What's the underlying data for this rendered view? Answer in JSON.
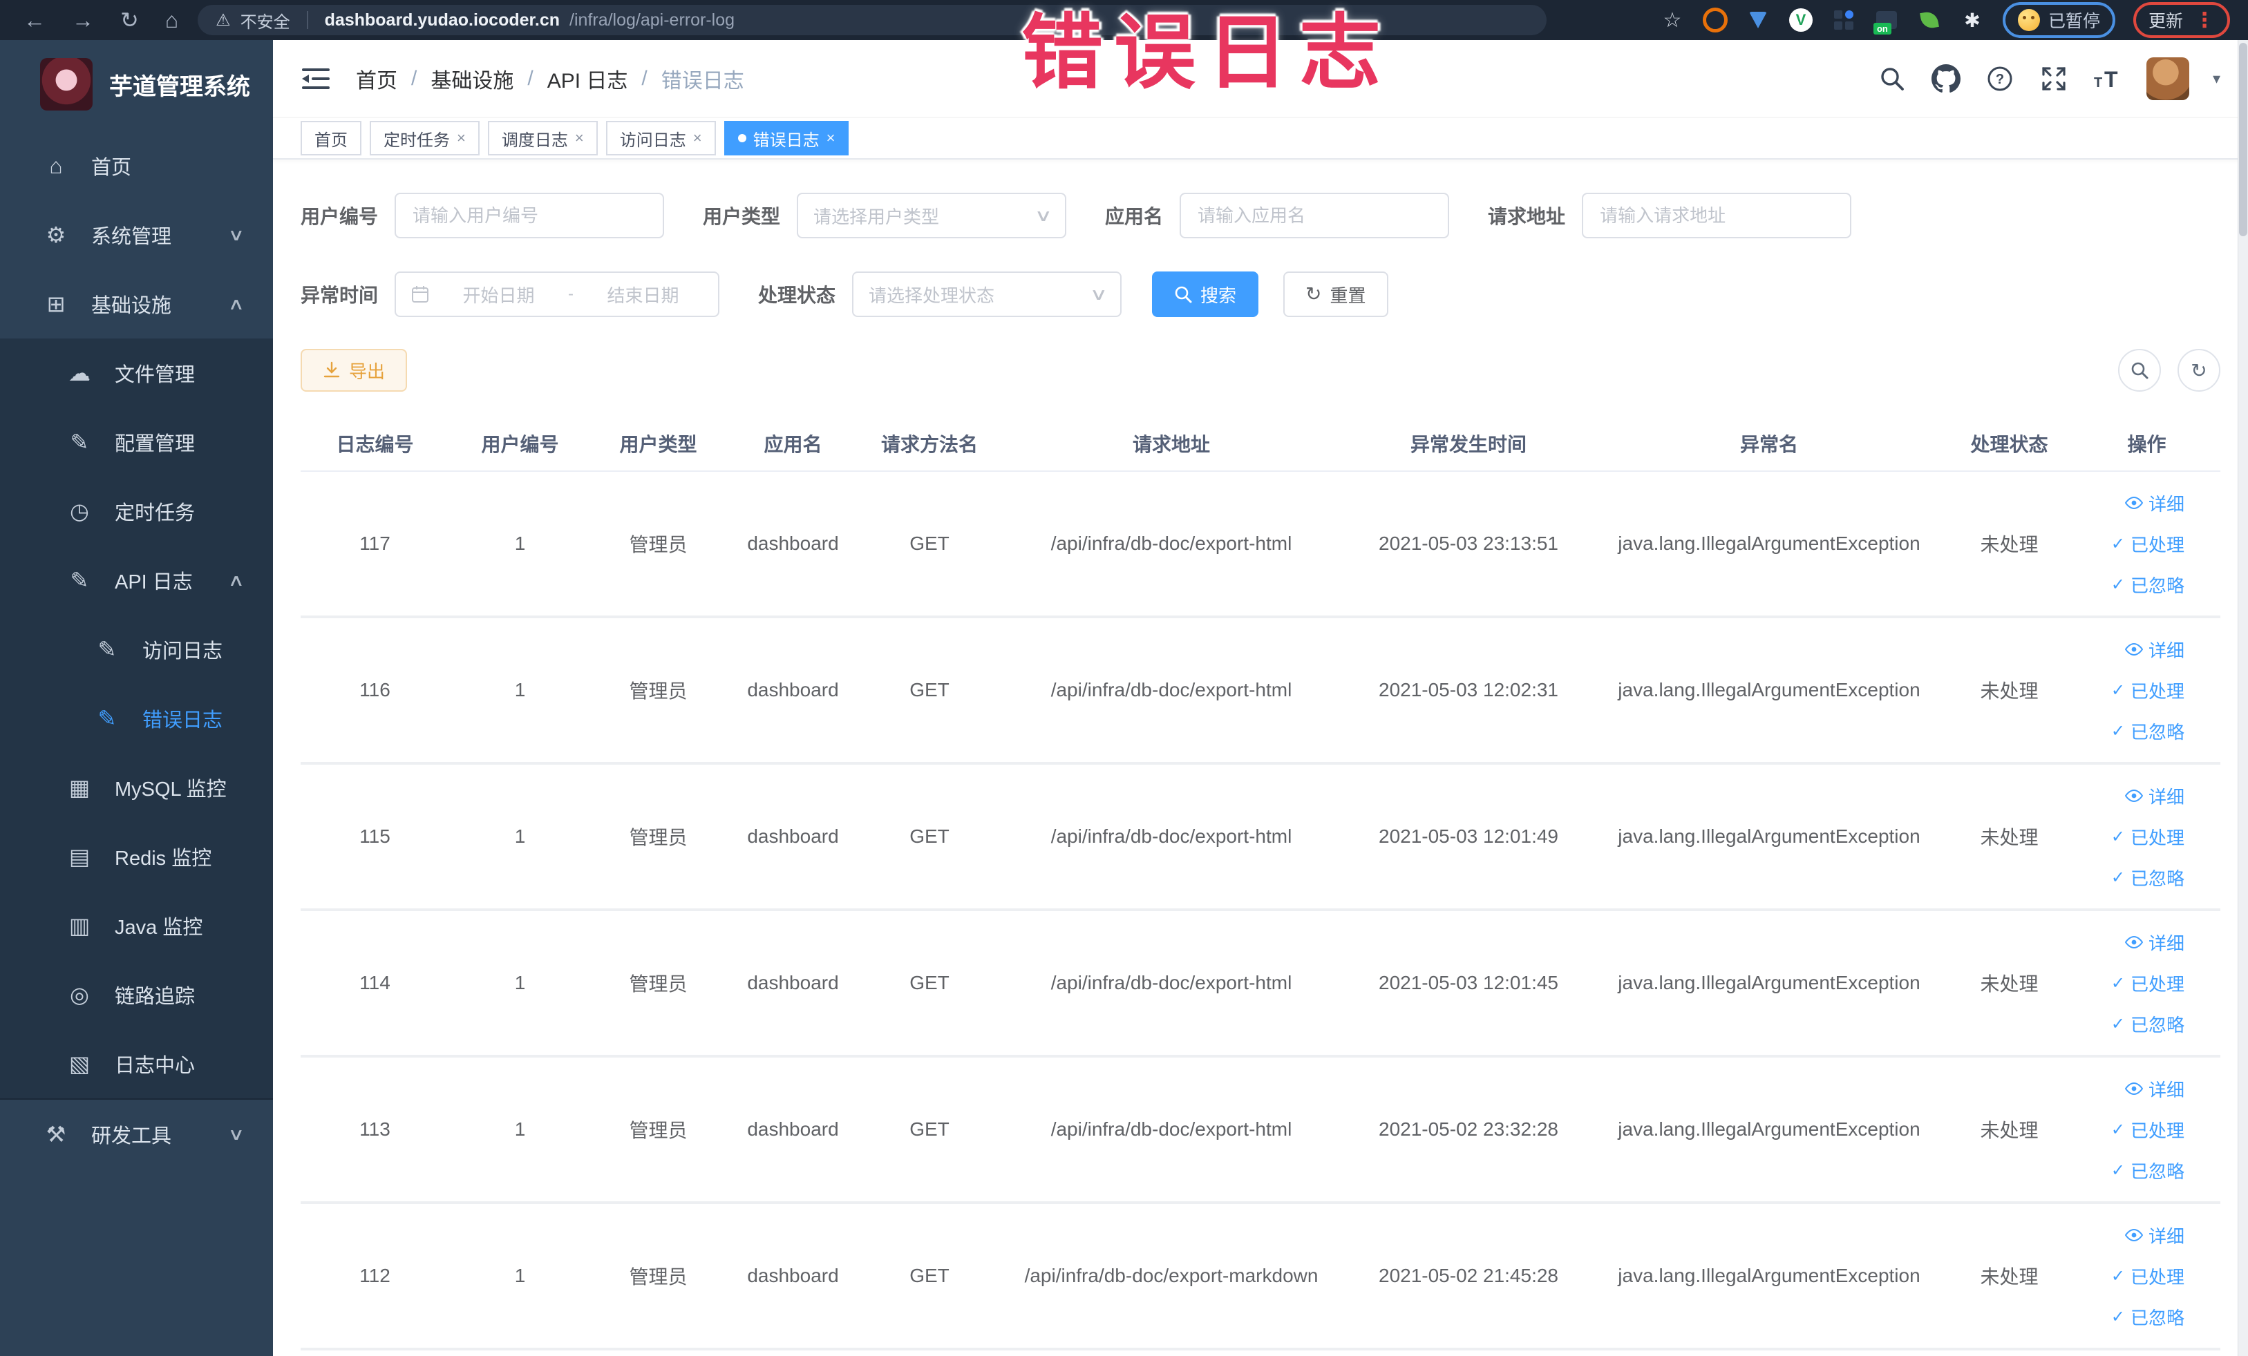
{
  "chrome": {
    "security_label": "不安全",
    "url_domain": "dashboard.yudao.iocoder.cn",
    "url_path": "/infra/log/api-error-log",
    "paused_label": "已暂停",
    "update_label": "更新"
  },
  "watermark": "错误日志",
  "sidebar": {
    "title": "芋道管理系统",
    "items": [
      {
        "label": "首页"
      },
      {
        "label": "系统管理"
      },
      {
        "label": "基础设施"
      },
      {
        "label": "文件管理"
      },
      {
        "label": "配置管理"
      },
      {
        "label": "定时任务"
      },
      {
        "label": "API 日志"
      },
      {
        "label": "访问日志"
      },
      {
        "label": "错误日志"
      },
      {
        "label": "MySQL 监控"
      },
      {
        "label": "Redis 监控"
      },
      {
        "label": "Java 监控"
      },
      {
        "label": "链路追踪"
      },
      {
        "label": "日志中心"
      },
      {
        "label": "研发工具"
      }
    ]
  },
  "breadcrumb": [
    "首页",
    "基础设施",
    "API 日志",
    "错误日志"
  ],
  "tabs": [
    {
      "label": "首页"
    },
    {
      "label": "定时任务"
    },
    {
      "label": "调度日志"
    },
    {
      "label": "访问日志"
    },
    {
      "label": "错误日志"
    }
  ],
  "filters": {
    "user_id": {
      "label": "用户编号",
      "placeholder": "请输入用户编号"
    },
    "user_type": {
      "label": "用户类型",
      "placeholder": "请选择用户类型"
    },
    "app_name": {
      "label": "应用名",
      "placeholder": "请输入应用名"
    },
    "request_url": {
      "label": "请求地址",
      "placeholder": "请输入请求地址"
    },
    "exception_time": {
      "label": "异常时间",
      "start_placeholder": "开始日期",
      "separator": "-",
      "end_placeholder": "结束日期"
    },
    "process_status": {
      "label": "处理状态",
      "placeholder": "请选择处理状态"
    },
    "search_label": "搜索",
    "reset_label": "重置"
  },
  "toolbar": {
    "export_label": "导出"
  },
  "table": {
    "headers": [
      "日志编号",
      "用户编号",
      "用户类型",
      "应用名",
      "请求方法名",
      "请求地址",
      "异常发生时间",
      "异常名",
      "处理状态",
      "操作"
    ],
    "action_labels": {
      "detail": "详细",
      "process": "已处理",
      "ignore": "已忽略"
    },
    "rows": [
      {
        "id": "117",
        "user_id": "1",
        "user_type": "管理员",
        "app": "dashboard",
        "method": "GET",
        "url": "/api/infra/db-doc/export-html",
        "time": "2021-05-03 23:13:51",
        "exception": "java.lang.IllegalArgumentException",
        "status": "未处理"
      },
      {
        "id": "116",
        "user_id": "1",
        "user_type": "管理员",
        "app": "dashboard",
        "method": "GET",
        "url": "/api/infra/db-doc/export-html",
        "time": "2021-05-03 12:02:31",
        "exception": "java.lang.IllegalArgumentException",
        "status": "未处理"
      },
      {
        "id": "115",
        "user_id": "1",
        "user_type": "管理员",
        "app": "dashboard",
        "method": "GET",
        "url": "/api/infra/db-doc/export-html",
        "time": "2021-05-03 12:01:49",
        "exception": "java.lang.IllegalArgumentException",
        "status": "未处理"
      },
      {
        "id": "114",
        "user_id": "1",
        "user_type": "管理员",
        "app": "dashboard",
        "method": "GET",
        "url": "/api/infra/db-doc/export-html",
        "time": "2021-05-03 12:01:45",
        "exception": "java.lang.IllegalArgumentException",
        "status": "未处理"
      },
      {
        "id": "113",
        "user_id": "1",
        "user_type": "管理员",
        "app": "dashboard",
        "method": "GET",
        "url": "/api/infra/db-doc/export-html",
        "time": "2021-05-02 23:32:28",
        "exception": "java.lang.IllegalArgumentException",
        "status": "未处理"
      },
      {
        "id": "112",
        "user_id": "1",
        "user_type": "管理员",
        "app": "dashboard",
        "method": "GET",
        "url": "/api/infra/db-doc/export-markdown",
        "time": "2021-05-02 21:45:28",
        "exception": "java.lang.IllegalArgumentException",
        "status": "未处理"
      }
    ]
  },
  "colors": {
    "primary": "#409eff",
    "warning": "#e6a23c",
    "watermark_red": "#e8365f",
    "sidebar_bg": "#2d4156",
    "sidebar_submenu_bg": "#233446",
    "chrome_bg": "#1c2634"
  }
}
